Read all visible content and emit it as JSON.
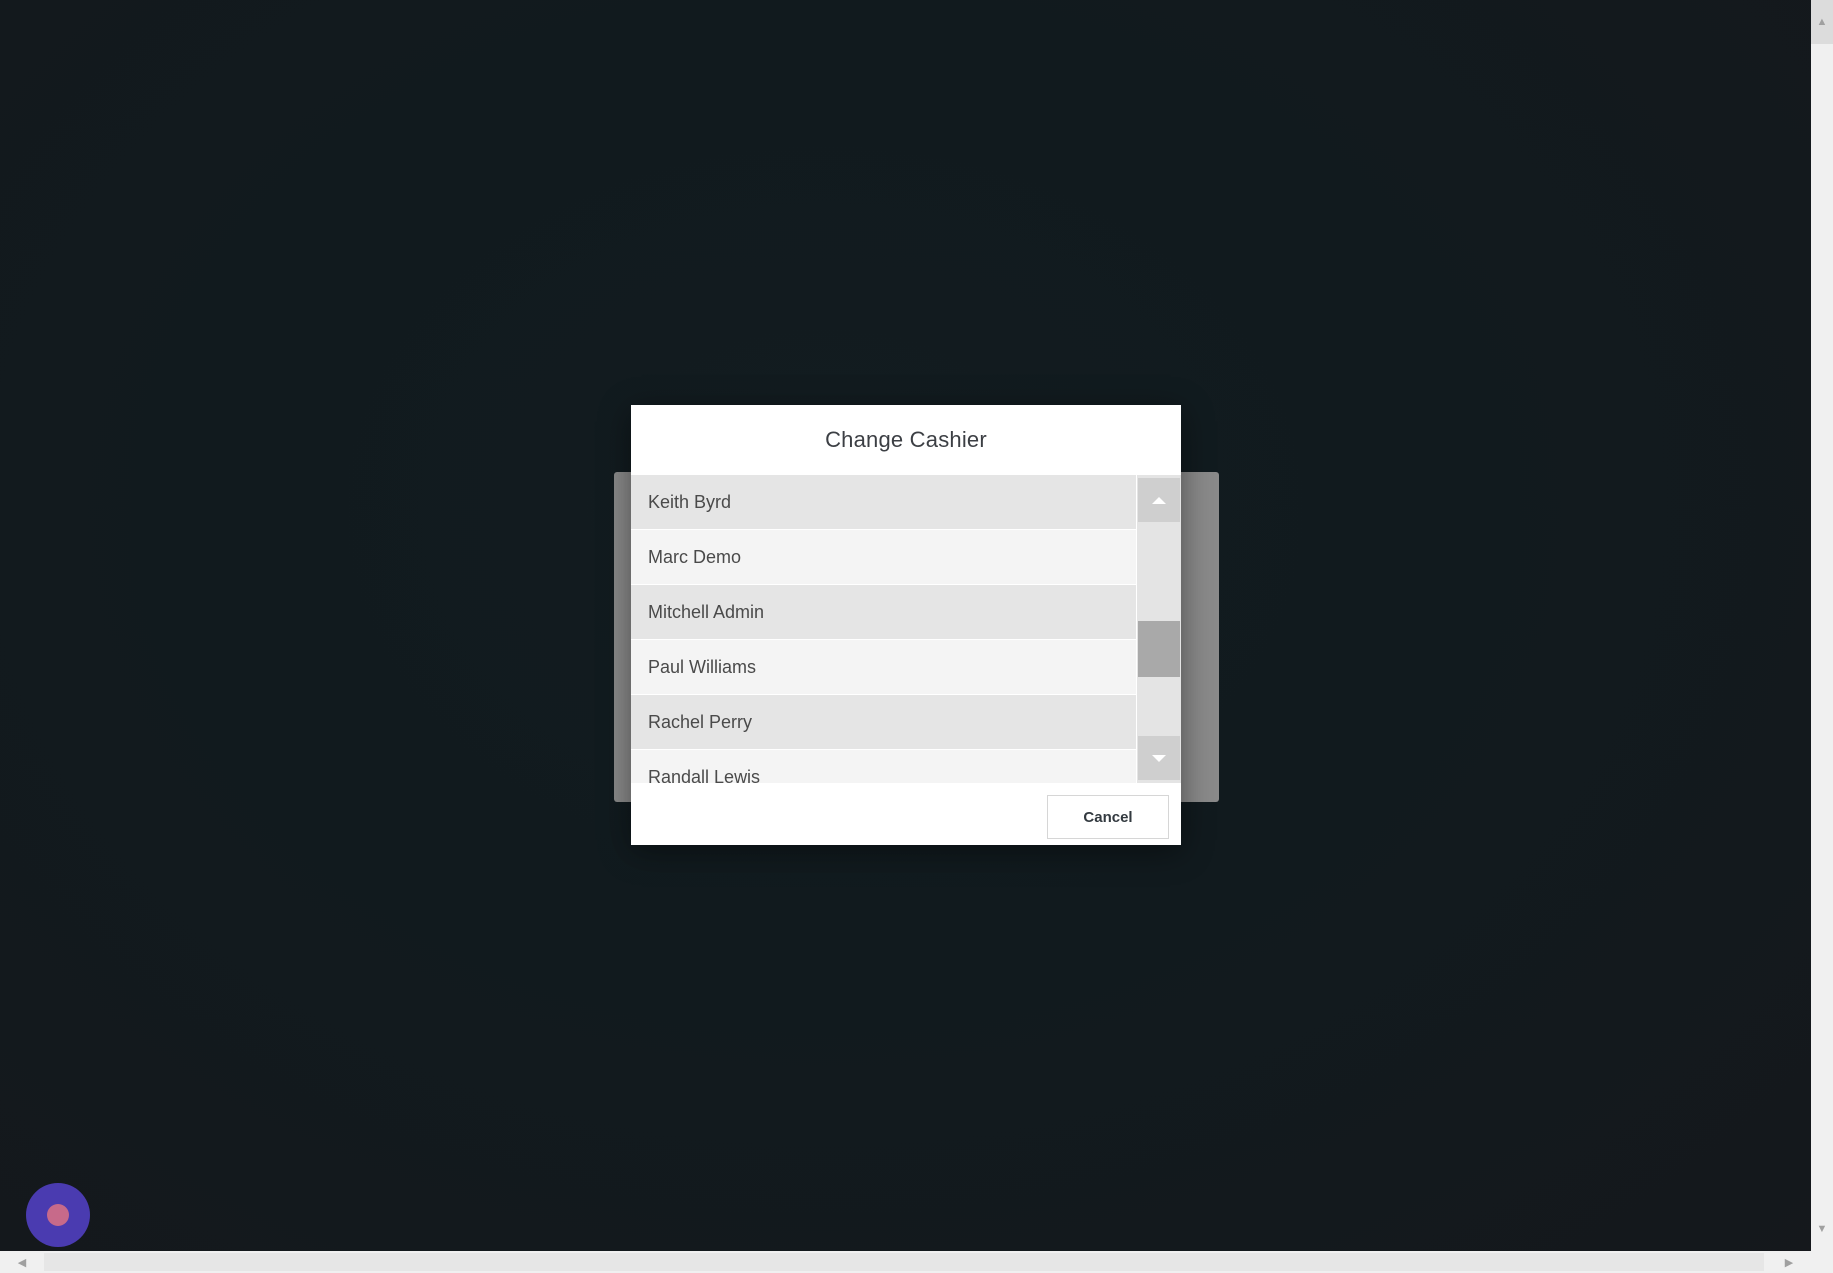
{
  "dialog": {
    "title": "Change Cashier",
    "cancel_label": "Cancel"
  },
  "cashiers": [
    "Keith Byrd",
    "Marc Demo",
    "Mitchell Admin",
    "Paul Williams",
    "Rachel Perry",
    "Randall Lewis"
  ],
  "icons": {
    "scroll_up": "triangle-up-icon",
    "scroll_down": "triangle-down-icon",
    "debug": "record-dot-icon"
  },
  "colors": {
    "background": "#111a1e",
    "dialog": "#ffffff",
    "row_odd": "#e5e5e5",
    "row_even": "#f4f4f4",
    "scroll_thumb": "#a9a9a9",
    "fab": "#4a3bb0",
    "fab_dot": "#c76a8a"
  }
}
